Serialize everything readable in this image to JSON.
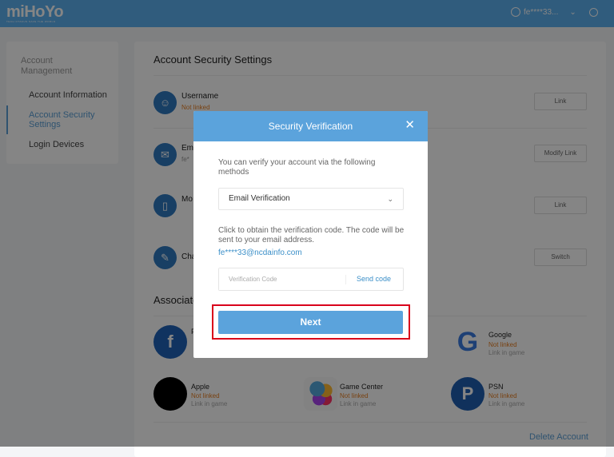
{
  "header": {
    "logo": "miHoYo",
    "tagline": "TECH OTAKUS SAVE THE WORLD",
    "user": "fe****33...",
    "chevron": "⌄"
  },
  "sidebar": {
    "heading": "Account Management",
    "items": [
      {
        "label": "Account Information"
      },
      {
        "label": "Account Security Settings",
        "active": true
      },
      {
        "label": "Login Devices"
      }
    ]
  },
  "main": {
    "title": "Account Security Settings",
    "rows": [
      {
        "label": "Username",
        "status": "Not linked",
        "button": "Link",
        "icon": "face-icon"
      },
      {
        "label": "Em",
        "status": "fe*",
        "button": "Modify Link",
        "icon": "mail-icon"
      },
      {
        "label": "Mo",
        "status": "",
        "button": "Link",
        "icon": "phone-icon"
      },
      {
        "label": "Cha",
        "status": "",
        "button": "Switch",
        "icon": "pencil-icon"
      }
    ],
    "associated_title": "Associate",
    "social": [
      {
        "name": "F",
        "status": "",
        "note": "",
        "icon": "facebook-icon"
      },
      {
        "name": "Google",
        "status": "Not linked",
        "note": "Link in game",
        "icon": "google-icon"
      },
      {
        "name": "Apple",
        "status": "Not linked",
        "note": "Link in game",
        "icon": "apple-icon"
      },
      {
        "name": "Game Center",
        "status": "Not linked",
        "note": "Link in game",
        "icon": "game-center-icon"
      },
      {
        "name": "PSN",
        "status": "Not linked",
        "note": "Link in game",
        "icon": "playstation-icon"
      }
    ],
    "delete": "Delete Account"
  },
  "modal": {
    "title": "Security Verification",
    "close": "✕",
    "intro": "You can verify your account via the following methods",
    "method": "Email Verification",
    "info": "Click to obtain the verification code. The code will be sent to your email address.",
    "email": "fe****33@ncdainfo.com",
    "code_placeholder": "Verification Code",
    "send": "Send code",
    "next": "Next"
  },
  "colors": {
    "accent": "#5ba3dc",
    "highlight": "#d9001b",
    "warning": "#e67e22"
  }
}
